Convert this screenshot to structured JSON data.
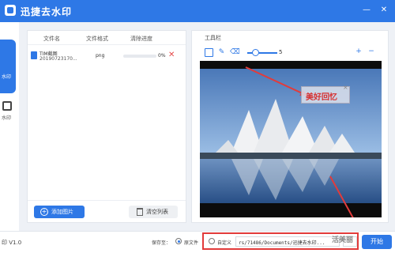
{
  "app": {
    "title": "迅捷去水印"
  },
  "window_controls": {
    "minimize": "—",
    "close": "✕"
  },
  "sidebar": {
    "items": [
      {
        "label": "水印",
        "active": true
      },
      {
        "label": "水印",
        "active": false
      }
    ]
  },
  "file_list": {
    "headers": {
      "name": "文件名",
      "format": "文件格式",
      "progress": "清除进度"
    },
    "rows": [
      {
        "name": "TIM截图",
        "date": "20190723170...",
        "format": "png",
        "progress_label": "0%",
        "progress_value": 0
      }
    ],
    "add_button": "添加图片",
    "clear_button": "清空列表"
  },
  "preview": {
    "toolbox_label": "工具栏",
    "brush_size": "5",
    "zoom_in": "+",
    "zoom_out": "−",
    "watermark_text": "美好回忆",
    "watermark_close": "×"
  },
  "bottom": {
    "version": "印 V1.0",
    "save_label": "保存至：",
    "option_original": "原文件",
    "option_custom": "自定义",
    "path": "rs/71486/Documents/迅捷去水印...",
    "browse": "...",
    "start": "开始"
  },
  "overlay": {
    "watermark": "活美丽"
  },
  "colors": {
    "accent": "#2e78e6",
    "delete": "#e54a4a",
    "highlight": "#e23b3b",
    "arrow": "#e23b3b"
  }
}
